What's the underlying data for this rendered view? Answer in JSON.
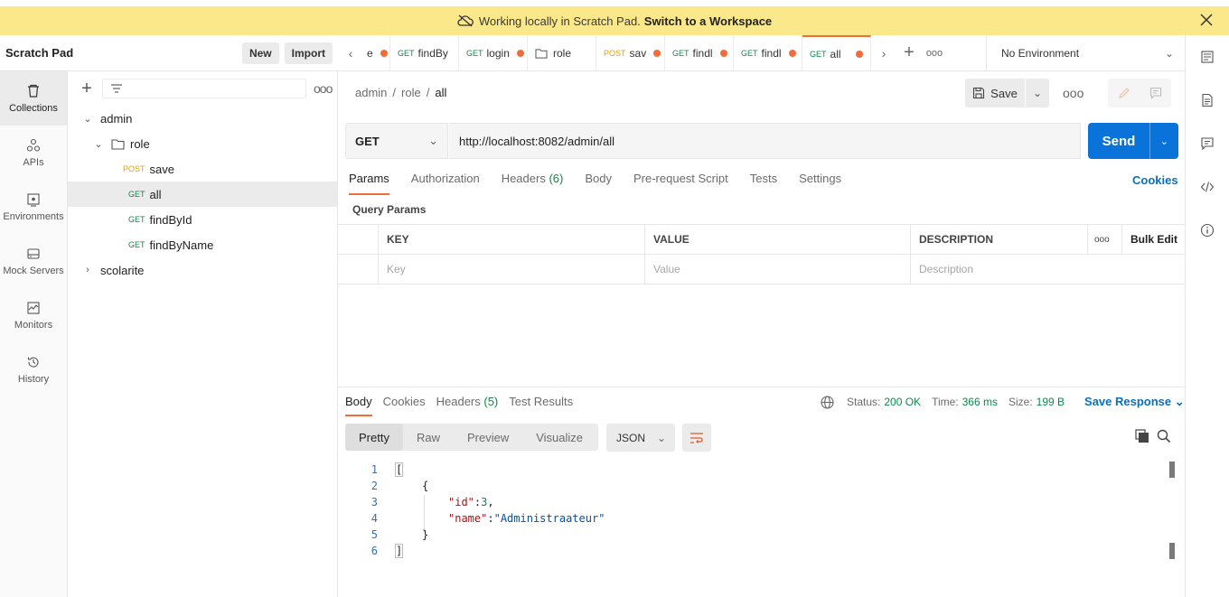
{
  "banner": {
    "text": "Working locally in Scratch Pad.",
    "link": "Switch to a Workspace"
  },
  "sidebar": {
    "title": "Scratch Pad",
    "new_label": "New",
    "import_label": "Import",
    "rail": [
      {
        "label": "Collections",
        "icon": "trash-can-icon"
      },
      {
        "label": "APIs",
        "icon": "apis-icon"
      },
      {
        "label": "Environments",
        "icon": "environments-icon"
      },
      {
        "label": "Mock Servers",
        "icon": "server-icon"
      },
      {
        "label": "Monitors",
        "icon": "monitor-icon"
      },
      {
        "label": "History",
        "icon": "history-icon"
      }
    ],
    "tree": {
      "collection": "admin",
      "folder": "role",
      "requests": [
        {
          "method": "POST",
          "name": "save"
        },
        {
          "method": "GET",
          "name": "all"
        },
        {
          "method": "GET",
          "name": "findById"
        },
        {
          "method": "GET",
          "name": "findByName"
        }
      ],
      "collection2": "scolarite"
    }
  },
  "tabs": [
    {
      "method": "",
      "name": "e"
    },
    {
      "method": "GET",
      "name": "findBy"
    },
    {
      "method": "GET",
      "name": "login"
    },
    {
      "method": "",
      "name": "role"
    },
    {
      "method": "POST",
      "name": "sav"
    },
    {
      "method": "GET",
      "name": "findl"
    },
    {
      "method": "GET",
      "name": "findl"
    },
    {
      "method": "GET",
      "name": "all"
    }
  ],
  "environment": "No Environment",
  "request": {
    "breadcrumb": [
      "admin",
      "role",
      "all"
    ],
    "save_label": "Save",
    "method": "GET",
    "url": "http://localhost:8082/admin/all",
    "send_label": "Send",
    "tabs": [
      "Params",
      "Authorization",
      "Headers",
      "Body",
      "Pre-request Script",
      "Tests",
      "Settings"
    ],
    "headers_count": "(6)",
    "cookies_label": "Cookies",
    "query_params_title": "Query Params",
    "columns": [
      "KEY",
      "VALUE",
      "DESCRIPTION"
    ],
    "bulk_edit": "Bulk Edit",
    "placeholders": [
      "Key",
      "Value",
      "Description"
    ]
  },
  "response": {
    "tabs": [
      "Body",
      "Cookies",
      "Headers",
      "Test Results"
    ],
    "headers_count": "(5)",
    "status_label": "Status:",
    "status": "200 OK",
    "time_label": "Time:",
    "time": "366 ms",
    "size_label": "Size:",
    "size": "199 B",
    "save_response": "Save Response",
    "views": [
      "Pretty",
      "Raw",
      "Preview",
      "Visualize"
    ],
    "format": "JSON",
    "line_numbers": [
      "1",
      "2",
      "3",
      "4",
      "5",
      "6"
    ],
    "json": {
      "id_key": "\"id\"",
      "id_value": "3",
      "name_key": "\"name\"",
      "name_value": "\"Administraateur\""
    }
  },
  "colors": {
    "banner": "#fbe88a",
    "accent": "#f26b3a",
    "send": "#0a73d9",
    "get": "#0a8a4a",
    "post": "#e0a400"
  }
}
